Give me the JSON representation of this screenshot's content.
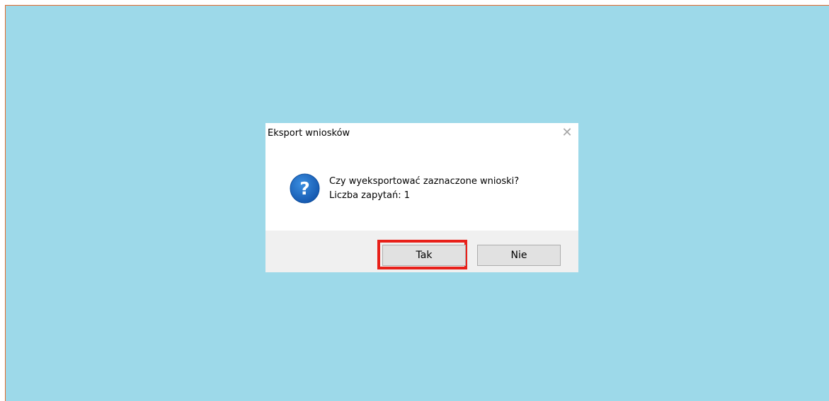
{
  "dialog": {
    "title": "Eksport wniosków",
    "close_icon": "close-icon",
    "icon": "question-icon",
    "message_line1": "Czy wyeksportować zaznaczone wnioski?",
    "message_line2": "Liczba zapytań: 1",
    "yes_label": "Tak",
    "no_label": "Nie"
  },
  "colors": {
    "background": "#9dd9e9",
    "screen_border": "#e06a2b",
    "highlight": "#e8201a",
    "question_icon": "#1a6fc4"
  }
}
